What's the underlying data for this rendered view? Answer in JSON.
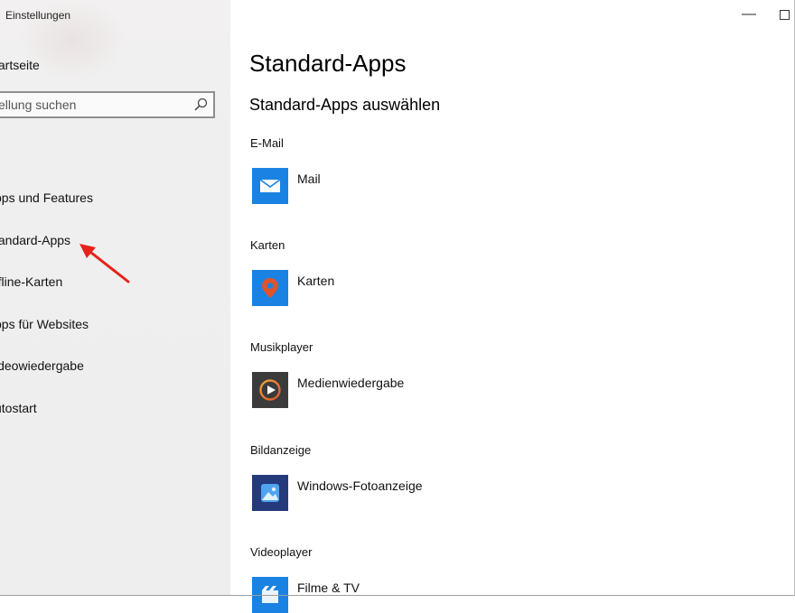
{
  "window": {
    "title": "Einstellungen",
    "minimize_glyph": "—",
    "maximize_glyph": "☐"
  },
  "sidebar": {
    "home_label": "tartseite",
    "search_placeholder": "ellung suchen",
    "items": [
      {
        "label": "pps und Features"
      },
      {
        "label": "tandard-Apps"
      },
      {
        "label": "ffline-Karten"
      },
      {
        "label": "pps für Websites"
      },
      {
        "label": "ideowiedergabe"
      },
      {
        "label": "utostart"
      }
    ]
  },
  "main": {
    "page_title": "Standard-Apps",
    "section_title": "Standard-Apps auswählen",
    "categories": [
      {
        "label": "E-Mail",
        "app": "Mail",
        "icon": "mail-icon",
        "color": "#1a82e2"
      },
      {
        "label": "Karten",
        "app": "Karten",
        "icon": "map-pin-icon",
        "color": "#1a82e2"
      },
      {
        "label": "Musikplayer",
        "app": "Medienwiedergabe",
        "icon": "media-player-icon",
        "color": "#3b3b3b"
      },
      {
        "label": "Bildanzeige",
        "app": "Windows-Fotoanzeige",
        "icon": "photo-icon",
        "color": "#243a7a"
      },
      {
        "label": "Videoplayer",
        "app": "Filme & TV",
        "icon": "film-icon",
        "color": "#1a82e2"
      }
    ]
  },
  "annotation": {
    "icon": "red-arrow-icon",
    "color": "#e5231b"
  }
}
